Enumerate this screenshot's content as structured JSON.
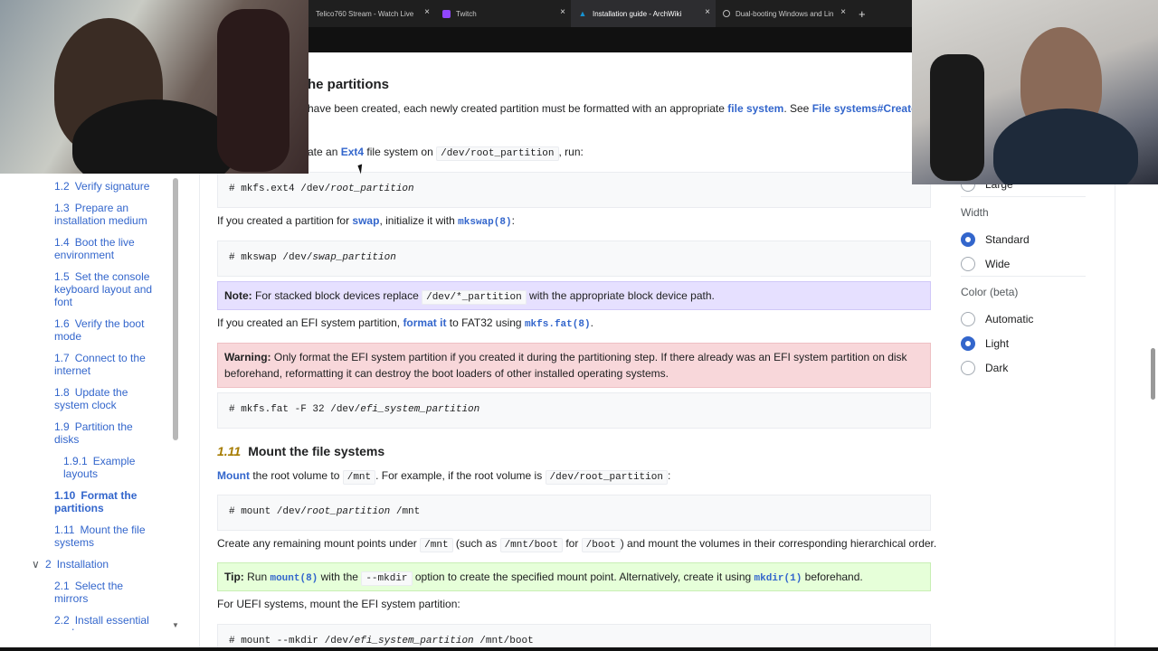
{
  "browser": {
    "tabs": [
      {
        "label": "Telico760 Stream - Watch Live",
        "icon": "stream-icon"
      },
      {
        "label": "Twitch",
        "icon": "twitch-icon"
      },
      {
        "label": "Installation guide - ArchWiki",
        "icon": "arch-icon",
        "active": true
      },
      {
        "label": "Dual-booting Windows and Lin",
        "icon": "globe-icon"
      }
    ],
    "close_glyph": "×",
    "newtab_glyph": "+"
  },
  "toc": {
    "items": [
      {
        "num": "1.2",
        "label": "Verify signature"
      },
      {
        "num": "1.3",
        "label": "Prepare an installation medium"
      },
      {
        "num": "1.4",
        "label": "Boot the live environment"
      },
      {
        "num": "1.5",
        "label": "Set the console keyboard layout and font"
      },
      {
        "num": "1.6",
        "label": "Verify the boot mode"
      },
      {
        "num": "1.7",
        "label": "Connect to the internet"
      },
      {
        "num": "1.8",
        "label": "Update the system clock"
      },
      {
        "num": "1.9",
        "label": "Partition the disks"
      },
      {
        "num": "1.9.1",
        "label": "Example layouts"
      },
      {
        "num": "1.10",
        "label": "Format the partitions"
      },
      {
        "num": "1.11",
        "label": "Mount the file systems"
      },
      {
        "num": "2",
        "label": "Installation"
      },
      {
        "num": "2.1",
        "label": "Select the mirrors"
      },
      {
        "num": "2.2",
        "label": "Install essential packages"
      }
    ],
    "chevron": "∨"
  },
  "content": {
    "section_title": "he partitions",
    "intro_pre": "have been created, each newly created partition must be formatted with an appropriate ",
    "intro_link1": "file system",
    "intro_mid": ". See ",
    "intro_link2": "File systems#Create a",
    "ext4_pre": "ate an ",
    "ext4_link": "Ext4",
    "ext4_mid": " file system on ",
    "ext4_code": "/dev/root_partition",
    "ext4_post": ", run:",
    "cmd_mkfs_ext4": "# mkfs.ext4 /dev/",
    "cmd_mkfs_ext4_var": "root_partition",
    "swap_pre": "If you created a partition for ",
    "swap_link": "swap",
    "swap_mid": ", initialize it with ",
    "swap_man": "mkswap(8)",
    "swap_post": ":",
    "cmd_mkswap": "# mkswap /dev/",
    "cmd_mkswap_var": "swap_partition",
    "note_label": "Note:",
    "note_pre": " For stacked block devices replace ",
    "note_code": "/dev/*_partition",
    "note_post": " with the appropriate block device path.",
    "efi_pre": "If you created an EFI system partition, ",
    "efi_link": "format it",
    "efi_mid": " to FAT32 using ",
    "efi_man": "mkfs.fat(8)",
    "efi_post": ".",
    "warning_label": "Warning:",
    "warning_text1": " Only format the EFI system partition if you created it during the partitioning step. If there already was an EFI system partition on disk",
    "warning_text2": "beforehand, reformatting it can destroy the boot loaders of other installed operating systems.",
    "cmd_mkfs_fat": "# mkfs.fat -F 32 /dev/",
    "cmd_mkfs_fat_var": "efi_system_partition",
    "mount_secnum": "1.11",
    "mount_title": "Mount the file systems",
    "mount_link": "Mount",
    "mount_mid": " the root volume to ",
    "mount_code1": "/mnt",
    "mount_mid2": ". For example, if the root volume is ",
    "mount_code2": "/dev/root_partition",
    "mount_post": ":",
    "cmd_mount": "# mount /dev/",
    "cmd_mount_var": "root_partition",
    "cmd_mount_post": " /mnt",
    "remain_pre": "Create any remaining mount points under ",
    "remain_code1": "/mnt",
    "remain_mid1": " (such as ",
    "remain_code2": "/mnt/boot",
    "remain_mid2": " for ",
    "remain_code3": "/boot",
    "remain_post": ") and mount the volumes in their corresponding hierarchical order.",
    "tip_label": "Tip:",
    "tip_pre": " Run ",
    "tip_man1": "mount(8)",
    "tip_mid1": " with the ",
    "tip_code": "--mkdir",
    "tip_mid2": " option to create the specified mount point. Alternatively, create it using ",
    "tip_man2": "mkdir(1)",
    "tip_post": " beforehand.",
    "uefi_text": "For UEFI systems, mount the EFI system partition:",
    "cmd_mount_efi": "# mount --mkdir /dev/",
    "cmd_mount_efi_var": "efi_system_partition",
    "cmd_mount_efi_post": " /mnt/boot"
  },
  "appearance": {
    "large_label": "Large",
    "width_heading": "Width",
    "width_options": [
      {
        "label": "Standard",
        "checked": true
      },
      {
        "label": "Wide",
        "checked": false
      }
    ],
    "color_heading": "Color (beta)",
    "color_options": [
      {
        "label": "Automatic",
        "checked": false
      },
      {
        "label": "Light",
        "checked": true
      },
      {
        "label": "Dark",
        "checked": false
      }
    ]
  },
  "colors": {
    "link": "#3366cc",
    "note_bg": "#e6e0ff",
    "warning_bg": "#f8d7da",
    "tip_bg": "#e6ffd9",
    "section_num": "#a67c00"
  }
}
